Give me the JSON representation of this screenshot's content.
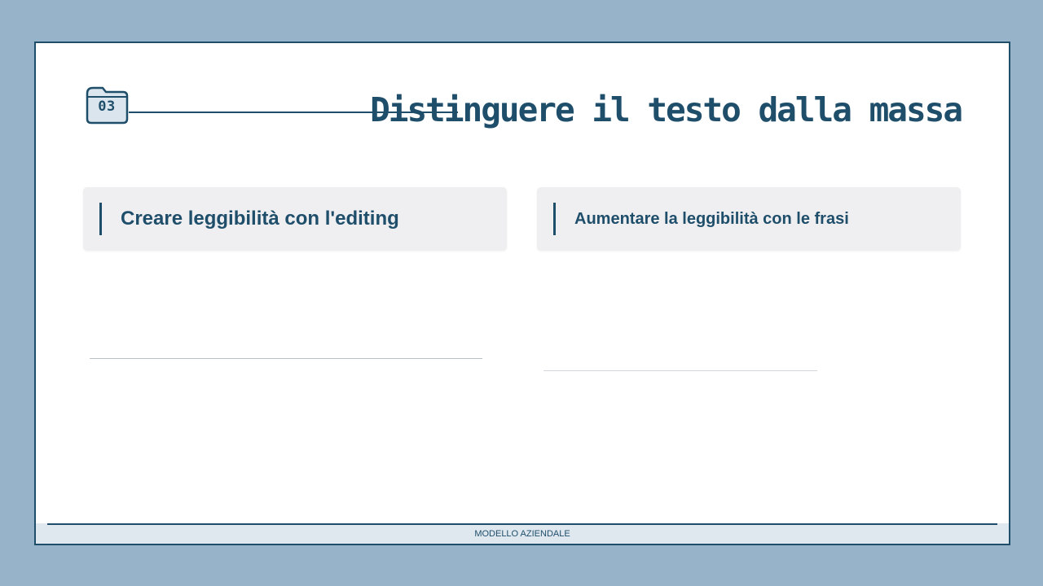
{
  "slide": {
    "section_number": "03",
    "title": "Distinguere il testo dalla massa"
  },
  "cards": [
    {
      "title": "Creare leggibilità con l'editing"
    },
    {
      "title": "Aumentare la leggibilità con le frasi"
    }
  ],
  "footer": {
    "text": "MODELLO AZIENDALE"
  },
  "icons": {
    "section_badge": "folder-icon"
  },
  "colors": {
    "accent": "#1f4e6b",
    "background": "#97b3c9",
    "card": "#efeff1",
    "footer": "#dfe7ef"
  }
}
